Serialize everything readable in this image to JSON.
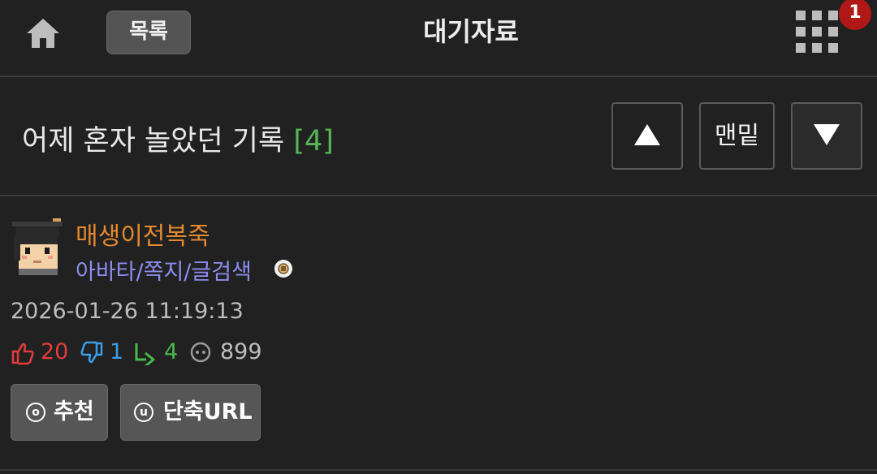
{
  "header": {
    "list_button": "목록",
    "board_title": "대기자료",
    "notification_count": "1"
  },
  "post": {
    "title": "어제 혼자 놀았던 기록",
    "comment_count": "[4]",
    "nav": {
      "up": "▲",
      "bottom": "맨밑",
      "down": "▼"
    },
    "author": {
      "nickname": "매생이전복죽",
      "links": "아바타/쪽지/글검색"
    },
    "date": "2026-01-26 11:19:13",
    "stats": {
      "upvotes": "20",
      "downvotes": "1",
      "replies": "4",
      "views": "899"
    },
    "actions": {
      "recommend_label": "추천",
      "recommend_key": "o",
      "short_url_label": "단축URL",
      "short_url_key": "u"
    }
  },
  "colors": {
    "background": "#212121",
    "author": "#e3892f",
    "links": "#8c8cf0",
    "comment_count": "#56b556",
    "upvote": "#e23c3c",
    "downvote": "#3a9ee8",
    "reply": "#4bb84b",
    "badge": "#b01818"
  }
}
